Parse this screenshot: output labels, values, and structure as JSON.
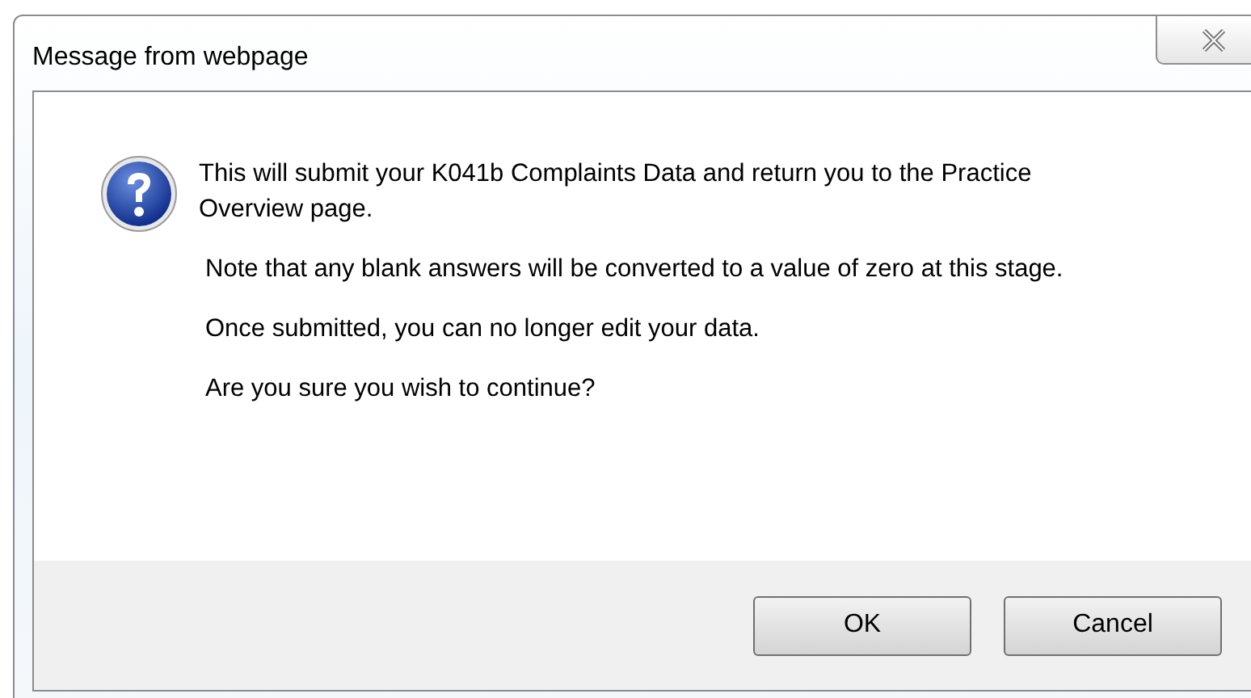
{
  "window": {
    "title": "Message from webpage"
  },
  "message": {
    "paragraphs": [
      "This will submit your K041b Complaints Data and return you to the Practice Overview page.",
      "Note that any blank answers will be converted to a value of zero at this stage.",
      "Once submitted, you can no longer edit your data.",
      "Are you sure you wish to continue?"
    ]
  },
  "buttons": [
    "OK",
    "Cancel"
  ]
}
